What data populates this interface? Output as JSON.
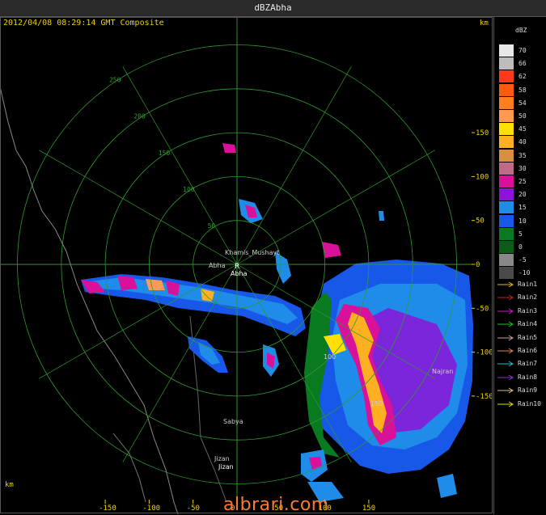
{
  "window": {
    "title": "dBZAbha"
  },
  "stamp": "2012/04/08 08:29:14 GMT Composite",
  "units": {
    "km_top_right": "km",
    "km_bottom_left": "km"
  },
  "legend": {
    "title": "dBZ",
    "levels": [
      {
        "value": "70",
        "color": "#e8e8e8"
      },
      {
        "value": "66",
        "color": "#bdbdbd"
      },
      {
        "value": "62",
        "color": "#ff3a1a"
      },
      {
        "value": "58",
        "color": "#ff5a10"
      },
      {
        "value": "54",
        "color": "#ff7f20"
      },
      {
        "value": "50",
        "color": "#ff9a50"
      },
      {
        "value": "45",
        "color": "#ffe000"
      },
      {
        "value": "40",
        "color": "#ffb020"
      },
      {
        "value": "35",
        "color": "#d89040"
      },
      {
        "value": "30",
        "color": "#c06a8a"
      },
      {
        "value": "25",
        "color": "#d8109a"
      },
      {
        "value": "20",
        "color": "#8c14d8"
      },
      {
        "value": "15",
        "color": "#1e8ce8"
      },
      {
        "value": "10",
        "color": "#1858e8"
      },
      {
        "value": "5",
        "color": "#0a7a20"
      },
      {
        "value": "0",
        "color": "#0a5c16"
      },
      {
        "value": "-5",
        "color": "#888888"
      },
      {
        "value": "-10",
        "color": "#4a4a4a"
      }
    ],
    "rain": [
      {
        "label": "Rain1",
        "color": "#e0c000"
      },
      {
        "label": "Rain2",
        "color": "#c02020"
      },
      {
        "label": "Rain3",
        "color": "#c020c0"
      },
      {
        "label": "Rain4",
        "color": "#20c020"
      },
      {
        "label": "Rain5",
        "color": "#c8a0a0"
      },
      {
        "label": "Rain6",
        "color": "#e08040"
      },
      {
        "label": "Rain7",
        "color": "#20c0c0"
      },
      {
        "label": "Rain8",
        "color": "#9030d0"
      },
      {
        "label": "Rain9",
        "color": "#e0c080"
      },
      {
        "label": "Rain10",
        "color": "#e0e000"
      }
    ]
  },
  "axes": {
    "x_ticks": [
      "-150",
      "-100",
      "-50",
      "0",
      "50",
      "100",
      "150"
    ],
    "y_ticks": [
      "150",
      "100",
      "50",
      "0",
      "-50",
      "-100",
      "-150"
    ],
    "ring_labels": [
      "50",
      "100",
      "150",
      "200",
      "250"
    ]
  },
  "places": [
    {
      "name": "Khamis_Mushayt"
    },
    {
      "name": "Abha"
    },
    {
      "name": "Abha"
    },
    {
      "name": "Sabya"
    },
    {
      "name": "Jizan"
    },
    {
      "name": "Jizan"
    },
    {
      "name": "Najran"
    },
    {
      "name": "100"
    },
    {
      "name": "150"
    }
  ],
  "watermark": "albrari.com",
  "colors": {
    "grid": "#2f9a2f",
    "axis_label": "#f0d000",
    "coast": "#888888"
  }
}
